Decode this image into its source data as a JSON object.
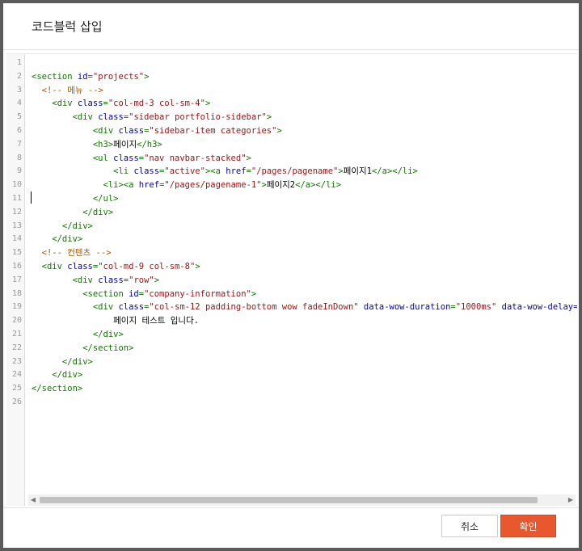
{
  "dialog": {
    "title": "코드블럭 삽입",
    "cancel_label": "취소",
    "confirm_label": "확인",
    "accent_color": "#e8572d"
  },
  "editor": {
    "line_numbers": [
      "1",
      "2",
      "3",
      "4",
      "5",
      "6",
      "7",
      "8",
      "9",
      "10",
      "11",
      "12",
      "13",
      "14",
      "15",
      "16",
      "17",
      "18",
      "19",
      "20",
      "21",
      "22",
      "23",
      "24",
      "25",
      "26"
    ],
    "lines": [
      [],
      [
        [
          "tag",
          "<section "
        ],
        [
          "attr",
          "id"
        ],
        [
          "tag",
          "="
        ],
        [
          "str",
          "\"projects\""
        ],
        [
          "tag",
          ">"
        ]
      ],
      [
        [
          "comment",
          "  <!-- 메뉴 -->"
        ]
      ],
      [
        [
          "tag",
          "    <div "
        ],
        [
          "attr",
          "class"
        ],
        [
          "tag",
          "="
        ],
        [
          "str",
          "\"col-md-3 col-sm-4\""
        ],
        [
          "tag",
          ">"
        ]
      ],
      [
        [
          "tag",
          "        <div "
        ],
        [
          "attr",
          "class"
        ],
        [
          "tag",
          "="
        ],
        [
          "str",
          "\"sidebar portfolio-sidebar\""
        ],
        [
          "tag",
          ">"
        ]
      ],
      [
        [
          "tag",
          "            <div "
        ],
        [
          "attr",
          "class"
        ],
        [
          "tag",
          "="
        ],
        [
          "str",
          "\"sidebar-item categories\""
        ],
        [
          "tag",
          ">"
        ]
      ],
      [
        [
          "tag",
          "            <h3>"
        ],
        [
          "text",
          "페이지"
        ],
        [
          "tag",
          "</h3>"
        ]
      ],
      [
        [
          "tag",
          "            <ul "
        ],
        [
          "attr",
          "class"
        ],
        [
          "tag",
          "="
        ],
        [
          "str",
          "\"nav navbar-stacked\""
        ],
        [
          "tag",
          ">"
        ]
      ],
      [
        [
          "tag",
          "                <li "
        ],
        [
          "attr",
          "class"
        ],
        [
          "tag",
          "="
        ],
        [
          "str",
          "\"active\""
        ],
        [
          "tag",
          "><a "
        ],
        [
          "attr",
          "href"
        ],
        [
          "tag",
          "="
        ],
        [
          "str",
          "\"/pages/pagename\""
        ],
        [
          "tag",
          ">"
        ],
        [
          "text",
          "페이지1"
        ],
        [
          "tag",
          "</a></li>"
        ]
      ],
      [
        [
          "tag",
          "              <li><a "
        ],
        [
          "attr",
          "href"
        ],
        [
          "tag",
          "="
        ],
        [
          "str",
          "\"/pages/pagename-1\""
        ],
        [
          "tag",
          ">"
        ],
        [
          "text",
          "페이지2"
        ],
        [
          "tag",
          "</a></li>"
        ]
      ],
      [
        [
          "tag",
          "            </ul>"
        ]
      ],
      [
        [
          "tag",
          "          </div>"
        ]
      ],
      [
        [
          "tag",
          "      </div>"
        ]
      ],
      [
        [
          "tag",
          "    </div>"
        ]
      ],
      [
        [
          "comment",
          "  <!-- 컨텐츠 -->"
        ]
      ],
      [
        [
          "tag",
          "  <div "
        ],
        [
          "attr",
          "class"
        ],
        [
          "tag",
          "="
        ],
        [
          "str",
          "\"col-md-9 col-sm-8\""
        ],
        [
          "tag",
          ">"
        ]
      ],
      [
        [
          "tag",
          "        <div "
        ],
        [
          "attr",
          "class"
        ],
        [
          "tag",
          "="
        ],
        [
          "str",
          "\"row\""
        ],
        [
          "tag",
          ">"
        ]
      ],
      [
        [
          "tag",
          "          <section "
        ],
        [
          "attr",
          "id"
        ],
        [
          "tag",
          "="
        ],
        [
          "str",
          "\"company-information\""
        ],
        [
          "tag",
          ">"
        ]
      ],
      [
        [
          "tag",
          "            <div "
        ],
        [
          "attr",
          "class"
        ],
        [
          "tag",
          "="
        ],
        [
          "str",
          "\"col-sm-12 padding-bottom wow fadeInDown\""
        ],
        [
          "tag",
          " "
        ],
        [
          "attr",
          "data-wow-duration"
        ],
        [
          "tag",
          "="
        ],
        [
          "str",
          "\"1000ms\""
        ],
        [
          "tag",
          " "
        ],
        [
          "attr",
          "data-wow-delay="
        ]
      ],
      [
        [
          "text",
          "                페이지 테스트 입니다."
        ]
      ],
      [
        [
          "tag",
          "            </div>"
        ]
      ],
      [
        [
          "tag",
          "          </section>"
        ]
      ],
      [
        [
          "tag",
          "      </div>"
        ]
      ],
      [
        [
          "tag",
          "    </div>"
        ]
      ],
      [
        [
          "tag",
          "</section>"
        ]
      ],
      []
    ]
  }
}
